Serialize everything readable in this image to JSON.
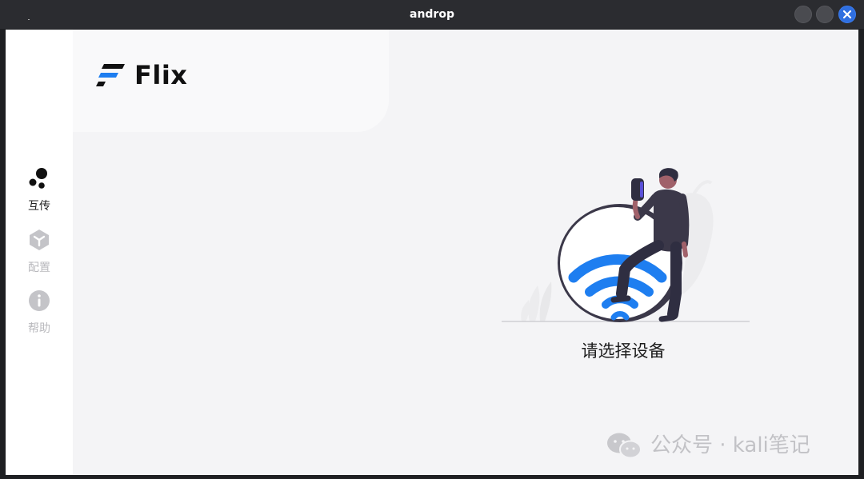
{
  "window": {
    "title": "androp"
  },
  "app": {
    "brand": "Flix"
  },
  "sidebar": {
    "items": [
      {
        "label": "互传",
        "icon": "dots-icon",
        "active": true
      },
      {
        "label": "配置",
        "icon": "cube-icon",
        "active": false
      },
      {
        "label": "帮助",
        "icon": "info-icon",
        "active": false
      }
    ]
  },
  "main": {
    "prompt": "请选择设备"
  },
  "watermark": {
    "text": "公众号 · kali笔记",
    "icon": "wechat-icon"
  },
  "colors": {
    "accent": "#1e7ef0",
    "titlebar": "#2b2c30",
    "background": "#f4f4f6"
  }
}
